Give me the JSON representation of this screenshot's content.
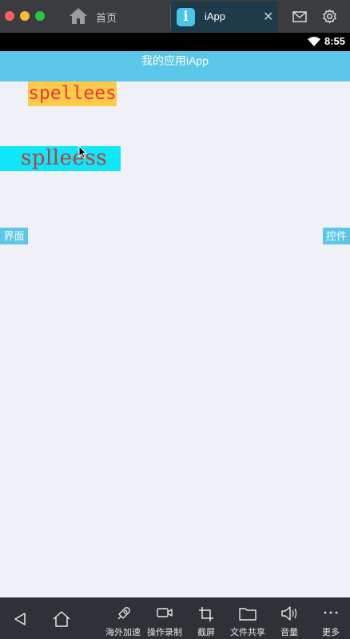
{
  "window": {
    "tabs": [
      {
        "label": "首页",
        "icon": "home-icon"
      },
      {
        "label": "iApp",
        "icon": "iapp-icon",
        "active": true
      }
    ],
    "app_icon_letter": "i",
    "close_glyph": "✕",
    "toolbar_icons": [
      "mail-icon",
      "gear-icon"
    ]
  },
  "statusbar": {
    "time": "8:55",
    "icon": "wifi-icon"
  },
  "appbar": {
    "title": "我的应用iApp"
  },
  "content": {
    "text1": "spellees",
    "text2": "splleess",
    "left_button": "界面",
    "right_button": "控件"
  },
  "bottombar": {
    "items": [
      {
        "label": "海外加速",
        "icon": "rocket-icon"
      },
      {
        "label": "操作录制",
        "icon": "video-icon"
      },
      {
        "label": "截屏",
        "icon": "crop-icon"
      },
      {
        "label": "文件共享",
        "icon": "folder-icon"
      },
      {
        "label": "音量",
        "icon": "volume-icon"
      },
      {
        "label": "更多",
        "icon": "more-icon"
      }
    ],
    "nav_icons": [
      "back-icon",
      "home-icon"
    ]
  },
  "colors": {
    "accent": "#5bc6e8",
    "box1_bg": "#ffc94a",
    "box2_bg": "#0de7f7",
    "text_red": "#e33b30"
  }
}
